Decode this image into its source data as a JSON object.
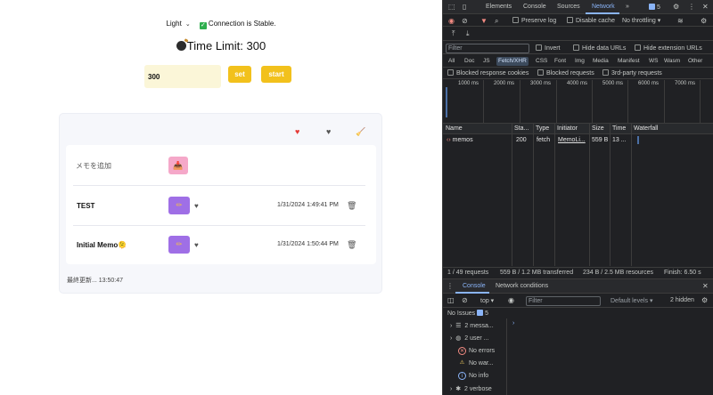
{
  "app": {
    "theme_select": "Light",
    "connection_status": "Connection is Stable.",
    "time_limit_label": "Time Limit: 300",
    "time_input_value": "300",
    "set_button": "set",
    "start_button": "start",
    "add_memo_placeholder": "メモを追加",
    "add_memo_icon": "📥",
    "memos": [
      {
        "title": "TEST",
        "timestamp": "1/31/2024 1:49:41 PM"
      },
      {
        "title": "Initial Memo🫠",
        "timestamp": "1/31/2024 1:50:44 PM"
      }
    ],
    "last_updated": "最終更新... 13:50:47",
    "icons": {
      "heart_red": "♥",
      "heart_grey": "♥",
      "broom": "🧹",
      "edit": "✏",
      "trash": "🗑"
    }
  },
  "devtools": {
    "tabs": [
      "Elements",
      "Console",
      "Sources",
      "Network"
    ],
    "active_tab": "Network",
    "more_tabs": "»",
    "issue_count": "5",
    "preserve_log": "Preserve log",
    "disable_cache": "Disable cache",
    "throttling": "No throttling",
    "filter_placeholder": "Filter",
    "invert": "Invert",
    "hide_data_urls": "Hide data URLs",
    "hide_extension_urls": "Hide extension URLs",
    "type_filters": [
      "All",
      "Doc",
      "JS",
      "Fetch/XHR",
      "CSS",
      "Font",
      "Img",
      "Media",
      "Manifest",
      "WS",
      "Wasm",
      "Other"
    ],
    "active_type_filter": "Fetch/XHR",
    "blocked_response_cookies": "Blocked response cookies",
    "blocked_requests": "Blocked requests",
    "third_party_requests": "3rd-party requests",
    "timeline_ticks": [
      "1000 ms",
      "2000 ms",
      "3000 ms",
      "4000 ms",
      "5000 ms",
      "6000 ms",
      "7000 ms"
    ],
    "columns": [
      "Name",
      "Sta...",
      "Type",
      "Initiator",
      "Size",
      "Time",
      "Waterfall"
    ],
    "requests": [
      {
        "name": "memos",
        "status": "200",
        "type": "fetch",
        "initiator": "MemoLi...",
        "size": "559 B",
        "time": "13 ..."
      }
    ],
    "status_bar": {
      "requests": "1 / 49 requests",
      "transferred": "559 B / 1.2 MB transferred",
      "resources": "234 B / 2.5 MB resources",
      "finish": "Finish: 6.50 s"
    },
    "drawer_tabs": [
      "Console",
      "Network conditions"
    ],
    "active_drawer_tab": "Console",
    "context": "top",
    "console_filter_placeholder": "Filter",
    "default_levels": "Default levels",
    "hidden_count": "2 hidden",
    "no_issues": "No Issues",
    "no_issues_badge": "5",
    "sidebar": [
      {
        "label": "2 messa...",
        "icon": "list-icon"
      },
      {
        "label": "2 user ...",
        "icon": "user-icon"
      },
      {
        "label": "No errors",
        "icon": "error-icon"
      },
      {
        "label": "No war...",
        "icon": "warning-icon"
      },
      {
        "label": "No info",
        "icon": "info-icon"
      },
      {
        "label": "2 verbose",
        "icon": "bug-icon"
      }
    ]
  }
}
